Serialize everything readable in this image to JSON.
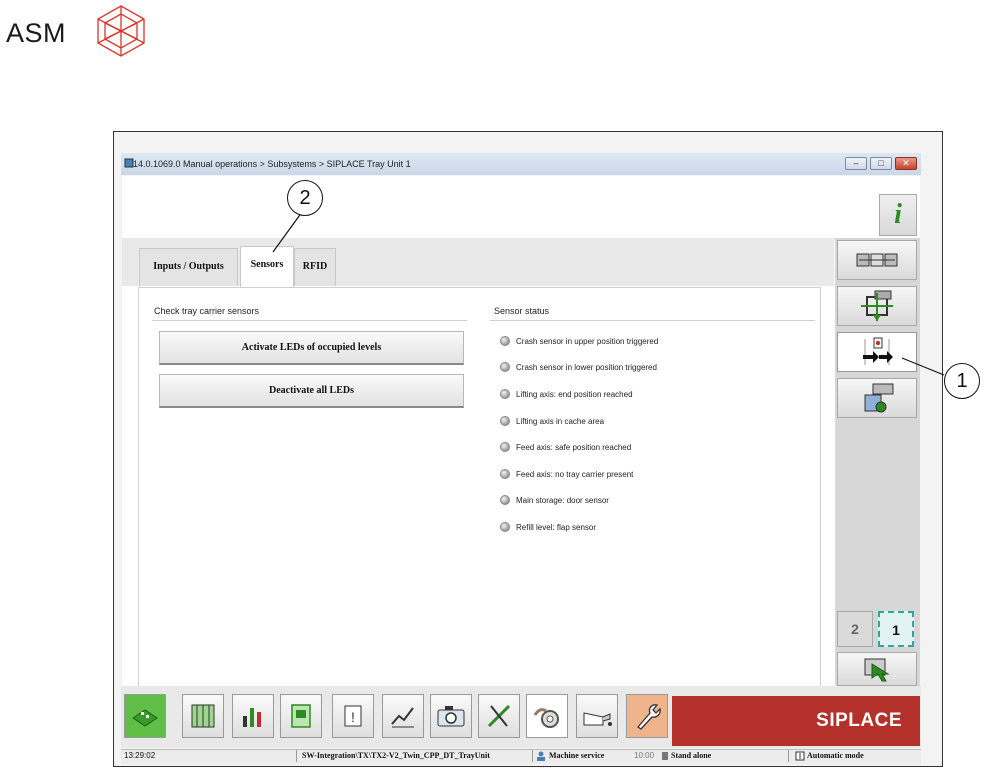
{
  "brand": {
    "company": "ASM",
    "product": "SIPLACE"
  },
  "window": {
    "title": "14.0.1069.0 Manual operations > Subsystems > SIPLACE Tray Unit 1",
    "controls": [
      "minimize",
      "maximize",
      "close"
    ]
  },
  "info_button": {
    "label": "i"
  },
  "tabs": [
    {
      "label": "Inputs / Outputs",
      "active": false
    },
    {
      "label": "Sensors",
      "active": true
    },
    {
      "label": "RFID",
      "active": false
    }
  ],
  "left_section": {
    "title": "Check tray carrier sensors",
    "buttons": [
      "Activate LEDs of occupied levels",
      "Deactivate all LEDs"
    ]
  },
  "sensor_section": {
    "title": "Sensor status",
    "sensors": [
      "Crash sensor in upper position triggered",
      "Crash sensor in lower position triggered",
      "Lifting axis: end position reached",
      "Lifting axis in cache area",
      "Feed axis: safe position reached",
      "Feed axis: no tray carrier present",
      "Main storage: door sensor",
      "Refill level: flap sensor"
    ]
  },
  "side_panel": {
    "buttons": [
      "subsystem-overview-icon",
      "tray-lift-icon",
      "sensor-view-icon",
      "tray-storage-icon"
    ],
    "active_index": 2
  },
  "stations": [
    {
      "label": "2",
      "active": false
    },
    {
      "label": "1",
      "active": true
    }
  ],
  "taskbar": {
    "buttons": [
      "production-icon",
      "setup-icon",
      "statistics-icon",
      "board-icon",
      "messages-icon",
      "charts-icon",
      "camera-icon",
      "tools-icon",
      "machine-service-icon",
      "maintenance-icon",
      "service-wrench-icon"
    ]
  },
  "statusbar": {
    "time": "13:29:02",
    "path": "SW-Integration\\TX\\TX2-V2_Twin_CPP_DT_TrayUnit",
    "user_role": "Machine service",
    "time_small": "10:00",
    "mode_line": "Stand alone",
    "operation_mode": "Automatic mode"
  },
  "callouts": [
    "1",
    "2"
  ],
  "colors": {
    "brand_red": "#b4302a",
    "info_green": "#2e8b22",
    "production_green": "#5fbf46",
    "service_orange": "#f0b48c",
    "station_active": "#e3f3f3"
  }
}
